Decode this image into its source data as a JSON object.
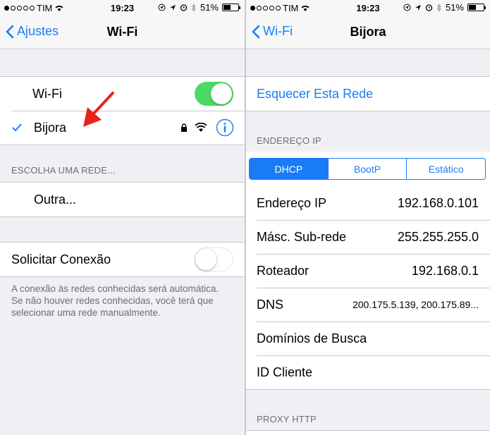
{
  "status": {
    "carrier": "TIM",
    "time": "19:23",
    "battery": "51%",
    "battery_level": 0.51
  },
  "left": {
    "back_label": "Ajustes",
    "title": "Wi-Fi",
    "wifi_label": "Wi-Fi",
    "wifi_enabled": true,
    "connected_network": "Bijora",
    "choose_network_header": "ESCOLHA UMA REDE...",
    "other_label": "Outra...",
    "ask_to_join_label": "Solicitar Conexão",
    "ask_to_join_enabled": false,
    "footer_text": "A conexão às redes conhecidas será automática. Se não houver redes conhecidas, você terá que selecionar uma rede manualmente."
  },
  "right": {
    "back_label": "Wi-Fi",
    "title": "Bijora",
    "forget_label": "Esquecer Esta Rede",
    "ip_header": "ENDEREÇO IP",
    "segments": [
      "DHCP",
      "BootP",
      "Estático"
    ],
    "selected_segment": "DHCP",
    "rows": [
      {
        "label": "Endereço IP",
        "value": "192.168.0.101"
      },
      {
        "label": "Másc. Sub-rede",
        "value": "255.255.255.0"
      },
      {
        "label": "Roteador",
        "value": "192.168.0.1"
      },
      {
        "label": "DNS",
        "value": "200.175.5.139, 200.175.89..."
      },
      {
        "label": "Domínios de Busca",
        "value": ""
      },
      {
        "label": "ID Cliente",
        "value": ""
      }
    ],
    "proxy_header": "PROXY HTTP"
  },
  "icons": [
    "chevron-left-icon",
    "checkmark-icon",
    "lock-icon",
    "wifi-signal-icon",
    "info-icon",
    "red-arrow-icon",
    "location-icon",
    "alarm-icon",
    "bluetooth-icon",
    "battery-icon"
  ],
  "colors": {
    "accent": "#1a7cf5",
    "toggle_on": "#4cd964",
    "arrow": "#e8241c",
    "background": "#efeff4"
  }
}
